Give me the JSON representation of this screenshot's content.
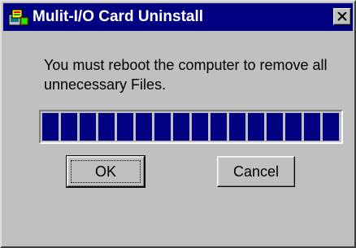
{
  "window": {
    "title": "Mulit-I/O Card Uninstall",
    "icon": "setup-app-icon",
    "close_label": "close"
  },
  "dialog": {
    "message": "You must reboot the computer to remove all unnecessary Files.",
    "progress": {
      "fraction": 1.0,
      "color": "#000080"
    }
  },
  "buttons": {
    "ok_label": "OK",
    "cancel_label": "Cancel"
  },
  "colors": {
    "titlebar": "#000080",
    "face": "#c0c0c0"
  }
}
